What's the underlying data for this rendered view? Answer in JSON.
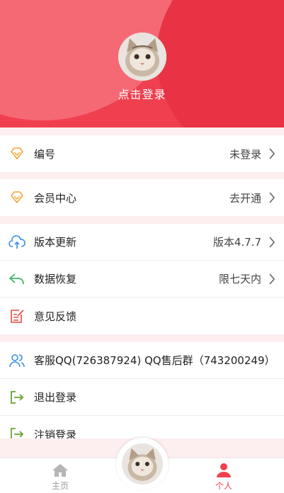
{
  "header": {
    "login_text": "点击登录",
    "colors": {
      "primary": "#f0404f"
    }
  },
  "rows": {
    "id": {
      "label": "编号",
      "value": "未登录",
      "icon": "diamond-icon"
    },
    "vip": {
      "label": "会员中心",
      "value": "去开通",
      "icon": "diamond-icon"
    },
    "update": {
      "label": "版本更新",
      "value": "版本4.7.7",
      "icon": "cloud-upload-icon"
    },
    "restore": {
      "label": "数据恢复",
      "value": "限七天内",
      "icon": "reply-arrow-icon"
    },
    "feedback": {
      "label": "意见反馈",
      "icon": "edit-note-icon"
    },
    "service": {
      "label": "客服QQ(726387924)  QQ售后群（743200249）",
      "icon": "users-icon"
    },
    "logout": {
      "label": "退出登录",
      "icon": "logout-icon"
    },
    "deregister": {
      "label": "注销登录",
      "icon": "logout-icon"
    }
  },
  "tabbar": {
    "home": "主页",
    "me": "个人"
  }
}
